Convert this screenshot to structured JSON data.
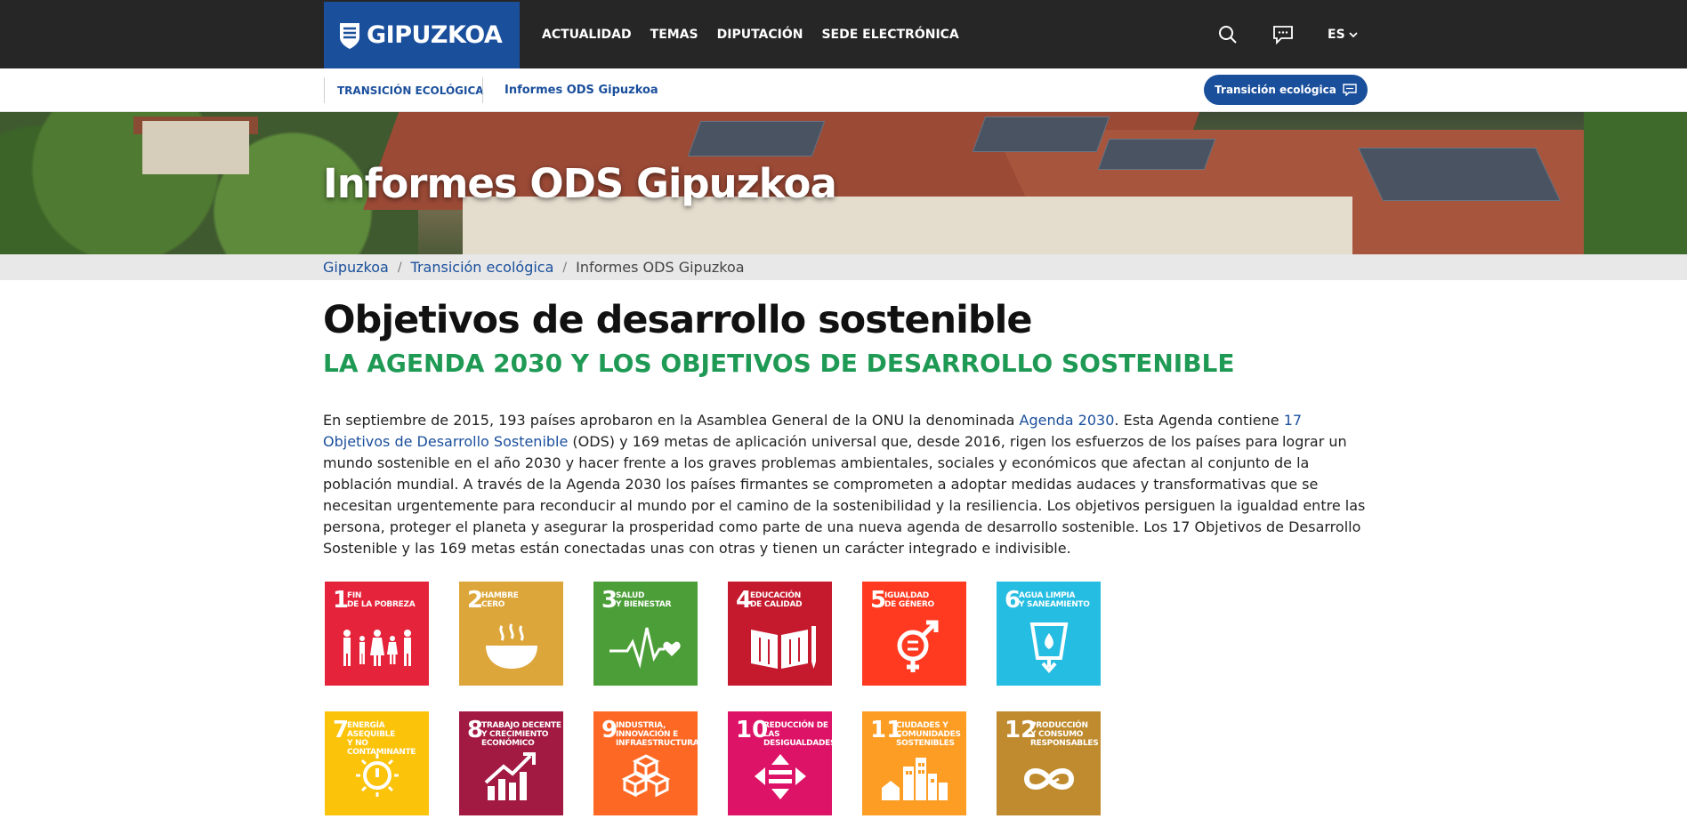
{
  "header": {
    "logo_text": "GIPUZKOA",
    "nav": [
      "ACTUALIDAD",
      "TEMAS",
      "DIPUTACIÓN",
      "SEDE ELECTRÓNICA"
    ],
    "search_icon": "search-icon",
    "chat_icon": "chat-icon",
    "language": "ES",
    "colors": {
      "bar": "#262626",
      "brand": "#1a4f9c"
    }
  },
  "subnav": {
    "section": "TRANSICIÓN ECOLÓGICA",
    "page": "Informes ODS Gipuzkoa",
    "button": "Transición ecológica"
  },
  "hero": {
    "title": "Informes ODS Gipuzkoa"
  },
  "breadcrumb": {
    "items": [
      "Gipuzkoa",
      "Transición ecológica"
    ],
    "current": "Informes ODS Gipuzkoa"
  },
  "main": {
    "title": "Objetivos de desarrollo sostenible",
    "subtitle": "LA AGENDA 2030 Y LOS OBJETIVOS DE DESARROLLO SOSTENIBLE",
    "intro": {
      "p1": "En septiembre de 2015, 193 países aprobaron en la Asamblea General de la ONU la denominada ",
      "link1": "Agenda 2030",
      "p2": ". Esta Agenda contiene ",
      "link2": "17 Objetivos de Desarrollo Sostenible",
      "p3": " (ODS) y 169 metas de aplicación universal que, desde 2016, rigen los esfuerzos de los países para lograr un mundo sostenible en el año 2030 y hacer frente a los graves problemas ambientales, sociales y económicos que afectan al conjunto de la población mundial. A través de la Agenda 2030 los países firmantes se comprometen a adoptar medidas audaces y transformativas que se necesitan urgentemente para reconducir al mundo por el camino de la sostenibilidad y la resiliencia. Los objetivos persiguen la igualdad entre las persona, proteger el planeta y asegurar la prosperidad como parte de una nueva agenda de desarrollo sostenible. Los 17 Objetivos de Desarrollo Sostenible y las 169 metas están conectadas unas con otras y tienen un carácter integrado e indivisible."
    }
  },
  "sdgs": [
    {
      "num": "1",
      "label": "FIN\nDE LA POBREZA",
      "color": "#e5243b",
      "icon": "family-icon"
    },
    {
      "num": "2",
      "label": "HAMBRE\nCERO",
      "color": "#dda63a",
      "icon": "bowl-icon"
    },
    {
      "num": "3",
      "label": "SALUD\nY BIENESTAR",
      "color": "#4c9f38",
      "icon": "heartbeat-icon"
    },
    {
      "num": "4",
      "label": "EDUCACIÓN\nDE CALIDAD",
      "color": "#c5192d",
      "icon": "book-icon"
    },
    {
      "num": "5",
      "label": "IGUALDAD\nDE GÉNERO",
      "color": "#ff3a21",
      "icon": "gender-equality-icon"
    },
    {
      "num": "6",
      "label": "AGUA LIMPIA\nY SANEAMIENTO",
      "color": "#26bde2",
      "icon": "water-icon"
    },
    {
      "num": "7",
      "label": "ENERGÍA ASEQUIBLE\nY NO CONTAMINANTE",
      "color": "#fcc30b",
      "icon": "sun-power-icon"
    },
    {
      "num": "8",
      "label": "TRABAJO DECENTE\nY CRECIMIENTO\nECONÓMICO",
      "color": "#a21942",
      "icon": "growth-chart-icon"
    },
    {
      "num": "9",
      "label": "INDUSTRIA,\nINNOVACIÓN E\nINFRAESTRUCTURA",
      "color": "#fd6925",
      "icon": "cubes-icon"
    },
    {
      "num": "10",
      "label": "REDUCCIÓN DE LAS\nDESIGUALDADES",
      "color": "#dd1367",
      "icon": "equality-arrows-icon"
    },
    {
      "num": "11",
      "label": "CIUDADES Y\nCOMUNIDADES\nSOSTENIBLES",
      "color": "#fd9d24",
      "icon": "city-icon"
    },
    {
      "num": "12",
      "label": "PRODUCCIÓN\nY CONSUMO\nRESPONSABLES",
      "color": "#bf8b2e",
      "icon": "infinity-icon"
    }
  ]
}
